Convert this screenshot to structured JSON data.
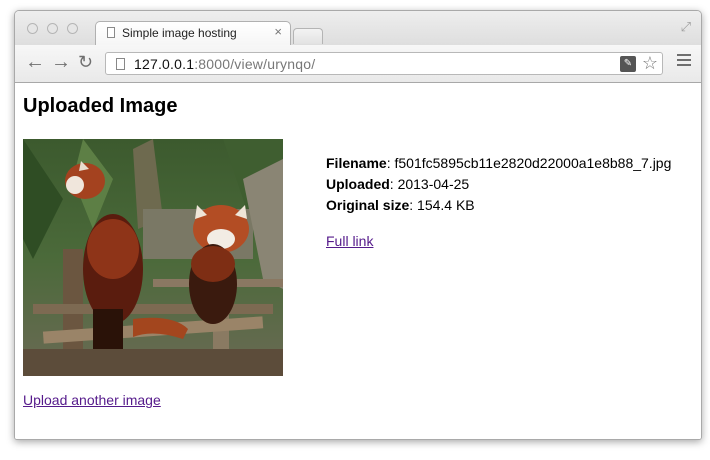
{
  "browser": {
    "tab_title": "Simple image hosting",
    "tab_close": "×",
    "url_host": "127.0.0.1",
    "url_rest": ":8000/view/urynqo/"
  },
  "page": {
    "heading": "Uploaded Image",
    "image": {
      "description_icon": "red-panda-photo"
    },
    "details": {
      "filename_label": "Filename",
      "filename_value": "f501fc5895cb11e2820d22000a1e8b88_7.jpg",
      "uploaded_label": "Uploaded",
      "uploaded_value": "2013-04-25",
      "size_label": "Original size",
      "size_value": "154.4 KB"
    },
    "full_link": "Full link",
    "upload_another": "Upload another image"
  },
  "colors": {
    "link_visited": "#551a8b"
  }
}
